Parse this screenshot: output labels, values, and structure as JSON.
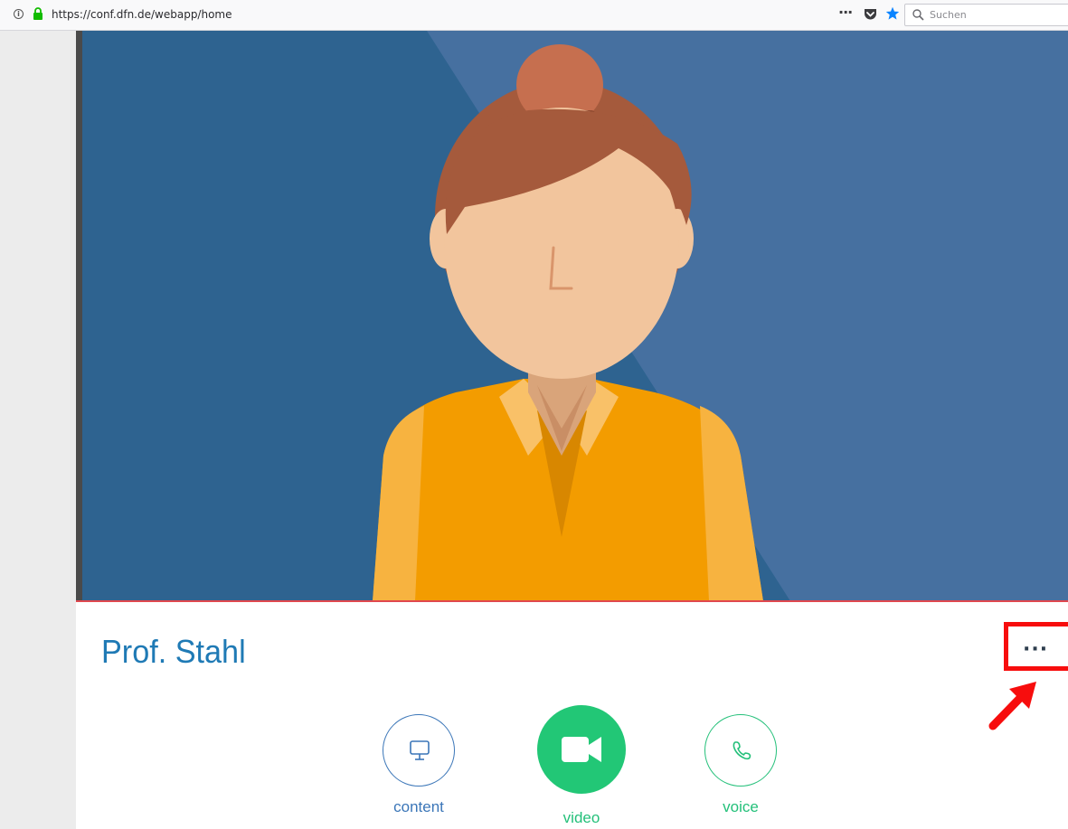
{
  "browser": {
    "url": "https://conf.dfn.de/webapp/home",
    "search_placeholder": "Suchen",
    "info_glyph": "i",
    "more_glyph": "···",
    "icons": [
      "info-icon",
      "lock-icon",
      "page-actions-icon",
      "pocket-icon",
      "bookmark-star-icon",
      "search-icon"
    ]
  },
  "call": {
    "caller_name": "Prof. Stahl",
    "options_glyph": "···",
    "buttons": [
      {
        "label": "content",
        "icon": "monitor-icon"
      },
      {
        "label": "video",
        "icon": "video-camera-icon"
      },
      {
        "label": "voice",
        "icon": "phone-icon"
      }
    ]
  },
  "colors": {
    "video_background": "#2e6390",
    "name_text": "#1f7ab5",
    "content_accent": "#3b76b8",
    "video_green": "#22c776",
    "highlight_red": "#f70d0d"
  }
}
